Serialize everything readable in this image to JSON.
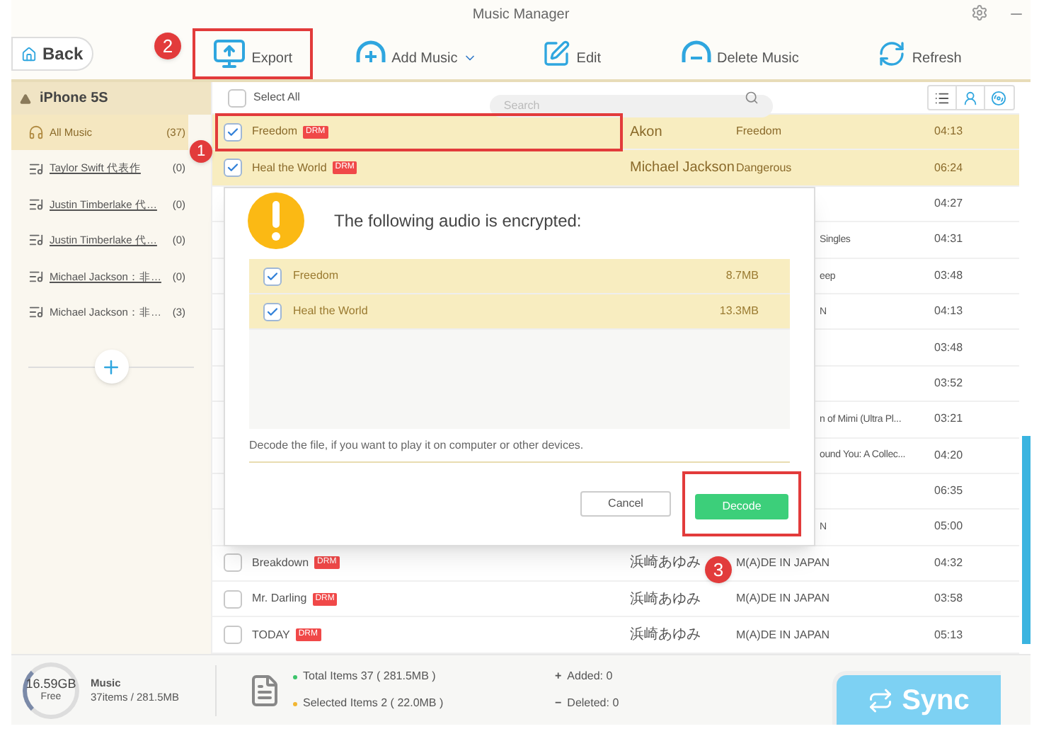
{
  "window": {
    "title": "Music Manager"
  },
  "toolbar": {
    "back": "Back",
    "actions": [
      {
        "kind": "export",
        "label": "Export",
        "framed": true,
        "dropdown": false
      },
      {
        "kind": "add",
        "label": "Add Music",
        "framed": false,
        "dropdown": true
      },
      {
        "kind": "edit",
        "label": "Edit",
        "framed": false,
        "dropdown": false
      },
      {
        "kind": "delete",
        "label": "Delete Music",
        "framed": false,
        "dropdown": false
      },
      {
        "kind": "refresh",
        "label": "Refresh",
        "framed": false,
        "dropdown": false
      }
    ]
  },
  "sidebar": {
    "device": "iPhone 5S",
    "items": [
      {
        "kind": "library",
        "label": "All Music",
        "count": "(37)",
        "selected": true,
        "underlined": false
      },
      {
        "kind": "playlist",
        "label": "Taylor Swift 代表作",
        "count": "(0)",
        "selected": false,
        "underlined": true
      },
      {
        "kind": "playlist",
        "label": "Justin Timberlake 代…",
        "count": "(0)",
        "selected": false,
        "underlined": true
      },
      {
        "kind": "playlist",
        "label": "Justin Timberlake 代…",
        "count": "(0)",
        "selected": false,
        "underlined": true
      },
      {
        "kind": "playlist",
        "label": "Michael Jackson：非…",
        "count": "(0)",
        "selected": false,
        "underlined": true
      },
      {
        "kind": "playlist",
        "label": "Michael Jackson：非…",
        "count": "(3)",
        "selected": false,
        "underlined": false
      }
    ]
  },
  "list": {
    "select_all": {
      "label": "Select All",
      "checked": false
    },
    "search": {
      "placeholder": "Search"
    },
    "rows": [
      {
        "kind": "song",
        "title": "Freedom",
        "badge": "DRM",
        "artist": "Akon",
        "album": "Freedom",
        "time": "04:13",
        "checked": true,
        "selected": true
      },
      {
        "kind": "song",
        "title": "Heal the World",
        "badge": "DRM",
        "artist": "Michael Jackson",
        "album": "Dangerous",
        "time": "06:24",
        "checked": true,
        "selected": true
      },
      {
        "kind": "covered",
        "time": "04:27"
      },
      {
        "kind": "covered",
        "fragment": "Singles",
        "time": "04:31"
      },
      {
        "kind": "covered",
        "fragment": "eep",
        "time": "03:48"
      },
      {
        "kind": "covered",
        "fragment": "N",
        "time": "04:13"
      },
      {
        "kind": "covered",
        "time": "03:48"
      },
      {
        "kind": "covered",
        "time": "03:52"
      },
      {
        "kind": "covered",
        "fragment": "n of Mimi (Ultra Pl...",
        "time": "03:21"
      },
      {
        "kind": "covered",
        "fragment": "ound You: A Collec...",
        "time": "04:20"
      },
      {
        "kind": "covered",
        "time": "06:35"
      },
      {
        "kind": "covered",
        "fragment": "N",
        "time": "05:00"
      },
      {
        "kind": "song",
        "title": "Breakdown",
        "badge": "DRM",
        "artist": "浜崎あゆみ",
        "album": "M(A)DE IN JAPAN",
        "time": "04:32",
        "checked": false,
        "selected": false
      },
      {
        "kind": "song",
        "title": "Mr. Darling",
        "badge": "DRM",
        "artist": "浜崎あゆみ",
        "album": "M(A)DE IN JAPAN",
        "time": "03:58",
        "checked": false,
        "selected": false
      },
      {
        "kind": "song",
        "title": "TODAY",
        "badge": "DRM",
        "artist": "浜崎あゆみ",
        "album": "M(A)DE IN JAPAN",
        "time": "05:13",
        "checked": false,
        "selected": false
      }
    ]
  },
  "dialog": {
    "title": "The following audio is encrypted:",
    "items": [
      {
        "name": "Freedom",
        "size": "8.7MB",
        "checked": true
      },
      {
        "name": "Heal the World",
        "size": "13.3MB",
        "checked": true
      }
    ],
    "note": "Decode the file, if you want to play it on computer or other devices.",
    "cancel": "Cancel",
    "confirm": "Decode"
  },
  "status": {
    "free": "16.59GB",
    "free_label": "Free",
    "category": "Music",
    "usage": "37items / 281.5MB",
    "totals": [
      {
        "label": "Total Items 37 ( 281.5MB )",
        "color": "#3cc46a"
      },
      {
        "label": "Selected Items 2 ( 22.0MB )",
        "color": "#f2b632"
      }
    ],
    "changes": [
      {
        "sign": "+",
        "label": "Added: 0"
      },
      {
        "sign": "−",
        "label": "Deleted: 0"
      }
    ],
    "sync": "Sync"
  },
  "annotations": [
    {
      "text": "1"
    },
    {
      "text": "2"
    },
    {
      "text": "3"
    }
  ]
}
